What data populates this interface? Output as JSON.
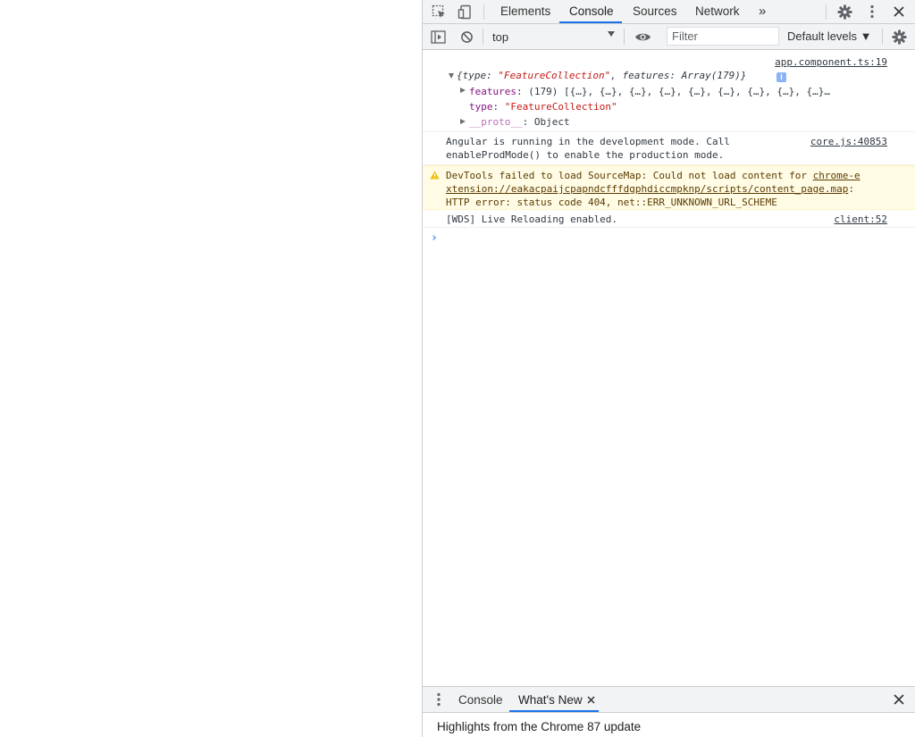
{
  "devtools": {
    "tabs": [
      "Elements",
      "Console",
      "Sources",
      "Network"
    ],
    "active_tab": "Console",
    "more_tabs_label": "»",
    "console_toolbar": {
      "context": "top",
      "filter_placeholder": "Filter",
      "levels": "Default levels ▼"
    },
    "messages": {
      "m1": {
        "source": "app.component.ts:19",
        "summary_pre": "{type: ",
        "summary_str": "\"FeatureCollection\"",
        "summary_mid": ", features: Array(179)}",
        "features_key": "features",
        "features_val": ": (179) [{…}, {…}, {…}, {…}, {…}, {…}, {…}, {…}, {…}…",
        "type_key": "type",
        "type_sep": ": ",
        "type_val": "\"FeatureCollection\"",
        "proto_key": "__proto__",
        "proto_val": ": Object"
      },
      "m2": {
        "source": "core.js:40853",
        "line1": "Angular is running in the development mode. Call",
        "line2": "enableProdMode() to enable the production mode."
      },
      "m3": {
        "line1_text": "DevTools failed to load SourceMap: Could not load content for ",
        "line1_link": "chrome-e",
        "line2_link": "xtension://eakacpaijcpapndcfffdgphdiccmpknp/scripts/content_page.map",
        "line2_tail": ":",
        "line3": "HTTP error: status code 404, net::ERR_UNKNOWN_URL_SCHEME"
      },
      "m4": {
        "source": "client:52",
        "text": "[WDS] Live Reloading enabled."
      }
    },
    "prompt_symbol": "›",
    "drawer": {
      "tabs": [
        "Console",
        "What's New"
      ],
      "active_tab": "What's New",
      "body": "Highlights from the Chrome 87 update"
    }
  }
}
